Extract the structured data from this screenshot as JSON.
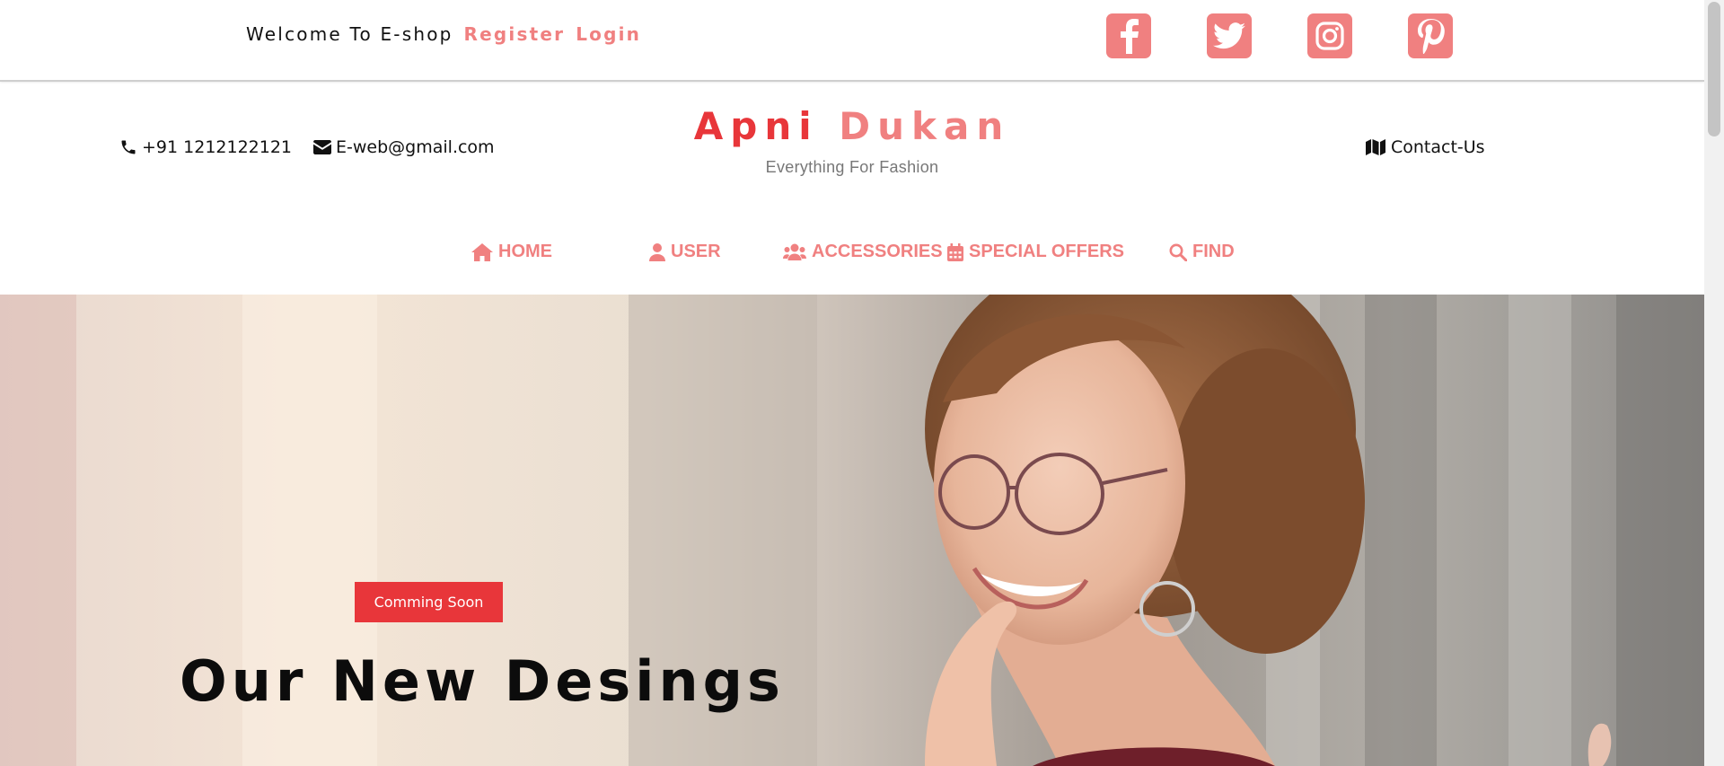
{
  "topbar": {
    "welcome_text": "Welcome To E-shop",
    "register_label": "Register",
    "login_label": "Login",
    "socials": [
      {
        "icon": "facebook-icon"
      },
      {
        "icon": "twitter-icon"
      },
      {
        "icon": "instagram-icon"
      },
      {
        "icon": "pinterest-icon"
      }
    ]
  },
  "header": {
    "phone": "+91 1212122121",
    "email": "E-web@gmail.com",
    "brand_part1": "Apni",
    "brand_part2": "Dukan",
    "tagline": "Everything For Fashion",
    "contact_label": "Contact-Us"
  },
  "nav": {
    "items": [
      {
        "label": "HOME",
        "icon": "home-icon"
      },
      {
        "label": "USER",
        "icon": "user-icon"
      },
      {
        "label": "ACCESSORIES",
        "icon": "users-icon"
      },
      {
        "label": "SPECIAL OFFERS",
        "icon": "calendar-icon"
      },
      {
        "label": "FIND",
        "icon": "search-icon"
      }
    ]
  },
  "hero": {
    "badge_label": "Comming Soon",
    "title": "Our New Desings"
  },
  "colors": {
    "accent": "#f08080",
    "brand_red": "#e8363a",
    "text_dark": "#111111",
    "tagline_gray": "#777777"
  }
}
